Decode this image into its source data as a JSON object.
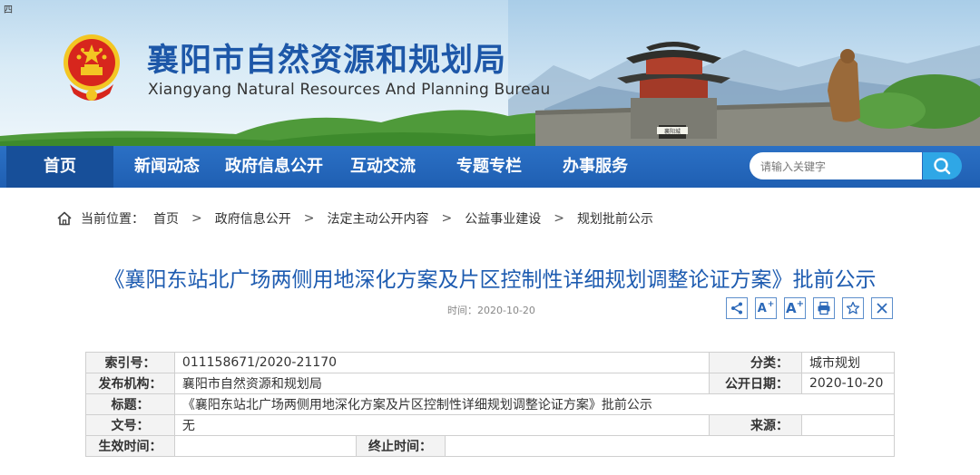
{
  "banner": {
    "corner_mark": "四",
    "title": "襄阳市自然资源和规划局",
    "subtitle": "Xiangyang Natural Resources And Planning Bureau",
    "gate_plaque": "襄阳城"
  },
  "nav": {
    "items": [
      {
        "label": "首页",
        "active": true
      },
      {
        "label": "新闻动态"
      },
      {
        "label": "政府信息公开"
      },
      {
        "label": "互动交流"
      },
      {
        "label": "专题专栏"
      },
      {
        "label": "办事服务"
      }
    ],
    "search_placeholder": "请输入关键字"
  },
  "breadcrumb": {
    "prefix": "当前位置：",
    "items": [
      "首页",
      "政府信息公开",
      "法定主动公开内容",
      "公益事业建设",
      "规划批前公示"
    ],
    "separator": ">"
  },
  "article": {
    "title": "《襄阳东站北广场两侧用地深化方案及片区控制性详细规划调整论证方案》批前公示",
    "time_label": "时间：",
    "time_value": "2020-10-20"
  },
  "tools": {
    "font_larger": "A",
    "font_largest": "A"
  },
  "info": {
    "index_label": "索引号：",
    "index_value": "011158671/2020-21170",
    "category_label": "分类：",
    "category_value": "城市规划",
    "publisher_label": "发布机构：",
    "publisher_value": "襄阳市自然资源和规划局",
    "pubdate_label": "公开日期：",
    "pubdate_value": "2020-10-20",
    "subject_label": "标题：",
    "subject_value": "《襄阳东站北广场两侧用地深化方案及片区控制性详细规划调整论证方案》批前公示",
    "docno_label": "文号：",
    "docno_value": "无",
    "source_label": "来源：",
    "source_value": "",
    "effective_label": "生效时间：",
    "effective_value": "",
    "expire_label": "终止时间：",
    "expire_value": ""
  },
  "colors": {
    "brand_blue": "#1d57a8",
    "nav_blue": "#2567bd",
    "nav_active": "#174f99",
    "search_button": "#2fa7e6",
    "emblem_red": "#d7261d",
    "emblem_gold": "#f3c623"
  }
}
